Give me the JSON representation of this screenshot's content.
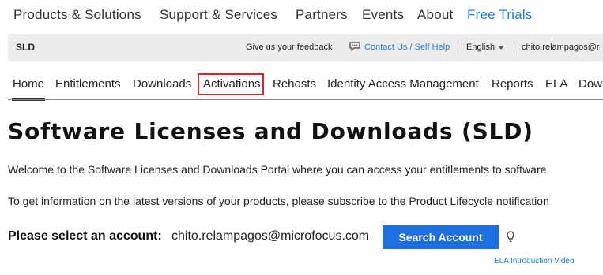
{
  "top_nav": {
    "items": [
      "Products & Solutions",
      "Support & Services",
      "Partners",
      "Events",
      "About",
      "Free Trials"
    ]
  },
  "header_bar": {
    "brand": "SLD",
    "feedback": "Give us your feedback",
    "contact": "Contact Us / Self Help",
    "language": "English",
    "user": "chito.relampagos@r"
  },
  "tabs": {
    "items": [
      "Home",
      "Entitlements",
      "Downloads",
      "Activations",
      "Rehosts",
      "Identity Access Management",
      "Reports",
      "ELA",
      "Dow"
    ],
    "active": "Home",
    "highlighted": "Activations"
  },
  "main": {
    "title": "Software Licenses and Downloads (SLD)",
    "welcome": "Welcome to the Software Licenses and Downloads Portal where you can access your entitlements to software",
    "info": "To get information on the latest versions of your products, please subscribe to the Product Lifecycle notification",
    "account_label": "Please select an account:",
    "account_value": "chito.relampagos@microfocus.com",
    "search_button": "Search Account",
    "ela_link": "ELA Introduction Video"
  },
  "colors": {
    "accent": "#1e7fd6",
    "button": "#1e6fe0",
    "highlight_border": "#d8262e",
    "bar_bg": "#ececec"
  },
  "icons": [
    "chat-icon",
    "caret-down-icon",
    "lightbulb-icon"
  ]
}
